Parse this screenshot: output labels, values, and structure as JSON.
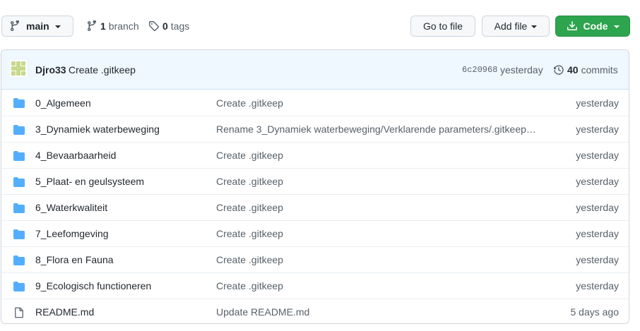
{
  "toolbar": {
    "branch_name": "main",
    "branch_count": "1",
    "branch_label": "branch",
    "tag_count": "0",
    "tag_label": "tags",
    "go_to_file": "Go to file",
    "add_file": "Add file",
    "code": "Code"
  },
  "latest_commit": {
    "author": "Djro33",
    "message": "Create .gitkeep",
    "sha": "6c20968",
    "when": "yesterday",
    "commit_count": "40",
    "commits_label": "commits"
  },
  "colors": {
    "accent_green": "#2da44e",
    "folder_blue": "#54aeff",
    "commit_bar_bg": "#f0f8ff"
  },
  "files": [
    {
      "type": "folder",
      "name": "0_Algemeen",
      "message": "Create .gitkeep",
      "age": "yesterday"
    },
    {
      "type": "folder",
      "name": "3_Dynamiek waterbeweging",
      "message": "Rename 3_Dynamiek waterbeweging/Verklarende parameters/.gitkeep t…",
      "age": "yesterday"
    },
    {
      "type": "folder",
      "name": "4_Bevaarbaarheid",
      "message": "Create .gitkeep",
      "age": "yesterday"
    },
    {
      "type": "folder",
      "name": "5_Plaat- en geulsysteem",
      "message": "Create .gitkeep",
      "age": "yesterday"
    },
    {
      "type": "folder",
      "name": "6_Waterkwaliteit",
      "message": "Create .gitkeep",
      "age": "yesterday"
    },
    {
      "type": "folder",
      "name": "7_Leefomgeving",
      "message": "Create .gitkeep",
      "age": "yesterday"
    },
    {
      "type": "folder",
      "name": "8_Flora en Fauna",
      "message": "Create .gitkeep",
      "age": "yesterday"
    },
    {
      "type": "folder",
      "name": "9_Ecologisch functioneren",
      "message": "Create .gitkeep",
      "age": "yesterday"
    },
    {
      "type": "file",
      "name": "README.md",
      "message": "Update README.md",
      "age": "5 days ago"
    }
  ]
}
